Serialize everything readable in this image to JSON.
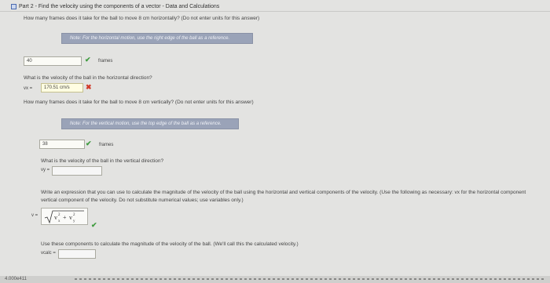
{
  "header": {
    "title": "Part 2 - Find the velocity using the components of a vector - Data and Calculations"
  },
  "q1": {
    "question": "How many frames does it take for the ball to move 8 cm horizontally? (Do not enter units for this answer)",
    "note": "Note: For the horizontal motion, use the right edge of the ball as a reference.",
    "answer": "40",
    "unit": "frames"
  },
  "q2": {
    "question": "What is the velocity of the ball in the horizontal direction?",
    "label": "vx =",
    "answer": "170.51 cm/s"
  },
  "q3": {
    "question": "How many frames does it take for the ball to move 8 cm vertically? (Do not enter units for this answer)",
    "note": "Note: For the vertical motion, use the top edge of the ball as a reference.",
    "answer": "38",
    "unit": "frames"
  },
  "q4": {
    "question": "What is the velocity of the ball in the vertical direction?",
    "label": "vy ="
  },
  "q5": {
    "question": "Write an expression that you can use to calculate the magnitude of the velocity of the ball using the horizontal and vertical components of the velocity. (Use the following as necessary: vx for the horizontal component",
    "question2": "vertical component of the velocity. Do not substitute numerical values; use variables only.)",
    "label": "v ="
  },
  "q6": {
    "question": "Use these components to calculate the magnitude of the velocity of the ball. (We'll call this the calculated velocity.)",
    "label": "vcalc ="
  },
  "footer": {
    "text": "4.000e411"
  },
  "colors": {
    "check": "#3f9b3f",
    "cross": "#d23a2a",
    "note_bg": "#9aa3b8"
  },
  "icons": {
    "check": "check-icon",
    "cross": "cross-icon",
    "header": "checkbox-icon"
  }
}
